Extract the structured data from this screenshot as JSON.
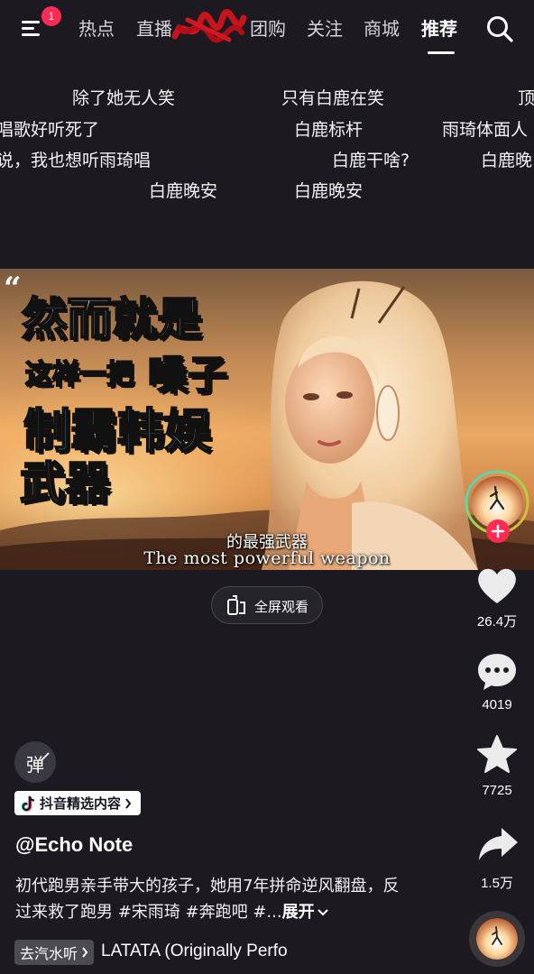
{
  "nav": {
    "notification_count": "1",
    "tabs": [
      {
        "label": "热点",
        "active": false
      },
      {
        "label": "直播",
        "active": false
      },
      {
        "label": "团购",
        "active": false
      },
      {
        "label": "关注",
        "active": false
      },
      {
        "label": "商城",
        "active": false
      },
      {
        "label": "推荐",
        "active": true
      }
    ]
  },
  "danmaku": [
    "除了她无人笑",
    "只有白鹿在笑",
    "顶",
    "唱歌好听死了",
    "白鹿标杆",
    "雨琦体面人",
    "说，我也想听雨琦唱",
    "白鹿干啥?",
    "白鹿晚",
    "白鹿晚安",
    "白鹿晚安"
  ],
  "video": {
    "overlay_lines": [
      "然而就是",
      "这样一把",
      "嗓子",
      "制霸韩娱",
      "武器"
    ],
    "subtitle_cn": "的最强武器",
    "subtitle_en": "The most powerful weapon"
  },
  "fullscreen": {
    "label": "全屏观看"
  },
  "rail": {
    "likes": "26.4万",
    "comments": "4019",
    "favorites": "7725",
    "shares": "1.5万"
  },
  "danmu_toggle": {
    "label": "弹"
  },
  "tag": {
    "label": "抖音精选内容"
  },
  "author": "@Echo Note",
  "description": {
    "text": "初代跑男亲手带大的孩子，她用7年拼命逆风翻盘，反过来救了跑男 #宋雨琦 #奔跑吧 #...",
    "expand_label": "展开"
  },
  "music": {
    "chip_label": "去汽水听",
    "title": "LATATA (Originally Perfo"
  },
  "colors": {
    "accent": "#fe2c55",
    "background": "#1c1a20"
  }
}
